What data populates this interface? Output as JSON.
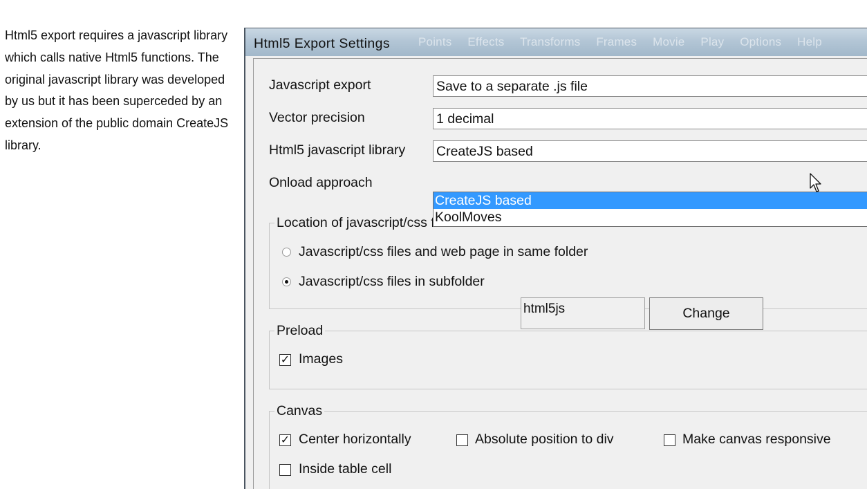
{
  "intro_text": "Html5 export requires a javascript library which calls native Html5 functions. The original javascript library was developed by us but it has been superceded by an extension of the public domain CreateJS library.",
  "window": {
    "title": "Html5 Export Settings",
    "background_menu": [
      "Points",
      "Effects",
      "Transforms",
      "Frames",
      "Movie",
      "Play",
      "Options",
      "Help"
    ]
  },
  "settings": {
    "javascript_export": {
      "label": "Javascript export",
      "value": "Save to a separate .js file"
    },
    "vector_precision": {
      "label": "Vector precision",
      "value": "1 decimal"
    },
    "library": {
      "label": "Html5 javascript library",
      "value": "CreateJS based",
      "options": [
        "CreateJS based",
        "KoolMoves"
      ],
      "highlighted_index": 0
    },
    "onload": {
      "label": "Onload approach"
    }
  },
  "location_group": {
    "title": "Location of javascript/css files",
    "same_folder_label": "Javascript/css files and web page in same folder",
    "same_folder_selected": false,
    "subfolder_label": "Javascript/css files in subfolder",
    "subfolder_selected": true,
    "folder_name": "html5js",
    "change_button": "Change"
  },
  "preload_group": {
    "title": "Preload",
    "images_label": "Images",
    "images_checked": true
  },
  "canvas_group": {
    "title": "Canvas",
    "center_label": "Center horizontally",
    "center_checked": true,
    "absolute_label": "Absolute position to div",
    "absolute_checked": false,
    "responsive_label": "Make canvas responsive",
    "responsive_checked": false,
    "table_cell_label": "Inside table cell",
    "table_cell_checked": false
  },
  "colors": {
    "selection": "#3399ff",
    "dialog_bg": "#f0f0f0",
    "title_bar": "#b3c6d6"
  },
  "icons": {
    "cursor": "arrow-cursor-icon",
    "check": "checkmark-icon"
  }
}
